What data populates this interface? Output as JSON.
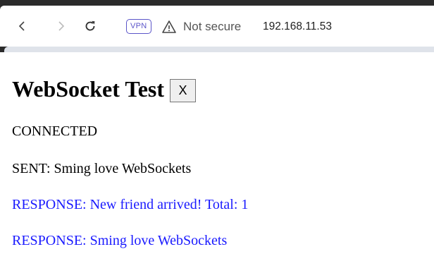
{
  "browser": {
    "vpn_badge": "VPN",
    "security_label": "Not secure",
    "url": "192.168.11.53"
  },
  "page": {
    "title": "WebSocket Test",
    "close_button_label": "X"
  },
  "log": [
    {
      "text": "CONNECTED",
      "color": "#000000"
    },
    {
      "text": "SENT: Sming love WebSockets",
      "color": "#000000"
    },
    {
      "text": "RESPONSE: New friend arrived! Total: 1",
      "color": "#1a1aff"
    },
    {
      "text": "RESPONSE: Sming love WebSockets",
      "color": "#1a1aff"
    }
  ]
}
